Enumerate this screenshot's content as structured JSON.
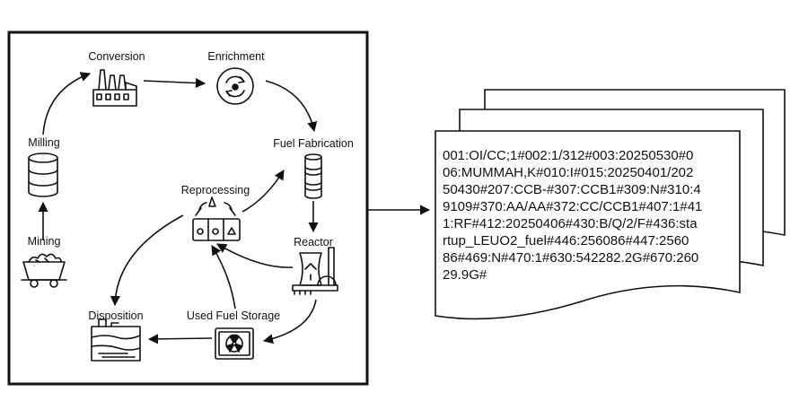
{
  "stages": {
    "conversion": "Conversion",
    "enrichment": "Enrichment",
    "milling": "Milling",
    "fuel_fabrication": "Fuel Fabrication",
    "reprocessing": "Reprocessing",
    "reactor": "Reactor",
    "mining": "Mining",
    "disposition": "Disposition",
    "used_fuel_storage": "Used Fuel Storage"
  },
  "record": {
    "lines": [
      "001:OI/CC;1#002:1/312#003:20250530#0",
      "06:MUMMAH,K#010:I#015:20250401/202",
      "50430#207:CCB-#307:CCB1#309:N#310:4",
      "9109#370:AA/AA#372:CC/CCB1#407:1#41",
      "1:RF#412:20250406#430:B/Q/2/F#436:sta",
      "rtup_LEUO2_fuel#446:256086#447:2560",
      "86#469:N#470:1#630:542282.2G#670:260",
      "29.9G#"
    ]
  },
  "icons": {
    "conversion": "factory-icon",
    "enrichment": "cycle-icon",
    "milling": "barrel-icon",
    "fuel_fabrication": "fuel-rod-icon",
    "reprocessing": "recycle-containers-icon",
    "reactor": "nuclear-plant-icon",
    "mining": "mine-cart-icon",
    "disposition": "geologic-repository-icon",
    "used_fuel_storage": "radioactive-cask-icon"
  }
}
